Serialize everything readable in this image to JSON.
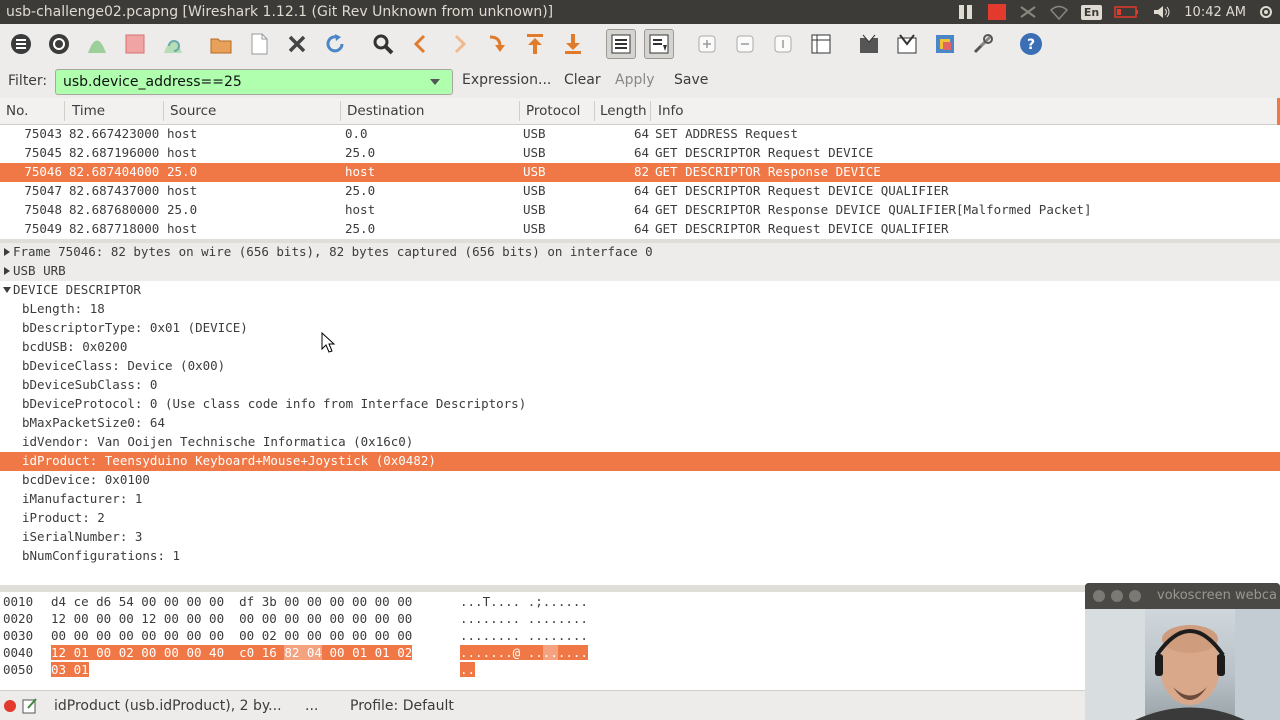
{
  "window": {
    "title": "usb-challenge02.pcapng   [Wireshark 1.12.1  (Git Rev Unknown from unknown)]",
    "tray": {
      "lang": "En",
      "time": "10:42 AM"
    }
  },
  "toolbar": {
    "icons": [
      "interfaces-icon",
      "options-icon",
      "start-capture-icon",
      "stop-capture-icon",
      "restart-capture-icon",
      "open-file-icon",
      "save-file-icon",
      "close-file-icon",
      "reload-icon",
      "find-packet-icon",
      "go-back-icon",
      "go-forward-icon",
      "go-to-packet-icon",
      "go-first-icon",
      "go-last-icon",
      "colorize-icon",
      "autoscroll-icon",
      "zoom-in-icon",
      "zoom-out-icon",
      "normal-size-icon",
      "resize-columns-icon",
      "capture-filters-icon",
      "display-filters-icon",
      "coloring-rules-icon",
      "preferences-icon",
      "help-icon"
    ]
  },
  "filter": {
    "label": "Filter:",
    "value": "usb.device_address==25",
    "expression_label": "Expression...",
    "clear_label": "Clear",
    "apply_label": "Apply",
    "save_label": "Save"
  },
  "packet_list": {
    "columns": [
      "No.",
      "Time",
      "Source",
      "Destination",
      "Protocol",
      "Length",
      "Info"
    ],
    "rows": [
      {
        "no": "75043",
        "time": "82.667423000",
        "source": "host",
        "destination": "0.0",
        "protocol": "USB",
        "length": "64",
        "info": "SET ADDRESS Request"
      },
      {
        "no": "75045",
        "time": "82.687196000",
        "source": "host",
        "destination": "25.0",
        "protocol": "USB",
        "length": "64",
        "info": "GET DESCRIPTOR Request DEVICE"
      },
      {
        "no": "75046",
        "time": "82.687404000",
        "source": "25.0",
        "destination": "host",
        "protocol": "USB",
        "length": "82",
        "info": "GET DESCRIPTOR Response DEVICE"
      },
      {
        "no": "75047",
        "time": "82.687437000",
        "source": "host",
        "destination": "25.0",
        "protocol": "USB",
        "length": "64",
        "info": "GET DESCRIPTOR Request DEVICE QUALIFIER"
      },
      {
        "no": "75048",
        "time": "82.687680000",
        "source": "25.0",
        "destination": "host",
        "protocol": "USB",
        "length": "64",
        "info": "GET DESCRIPTOR Response DEVICE QUALIFIER[Malformed Packet]"
      },
      {
        "no": "75049",
        "time": "82.687718000",
        "source": "host",
        "destination": "25.0",
        "protocol": "USB",
        "length": "64",
        "info": "GET DESCRIPTOR Request DEVICE QUALIFIER"
      }
    ],
    "selected_index": 2
  },
  "details": {
    "frame": "Frame 75046: 82 bytes on wire (656 bits), 82 bytes captured (656 bits) on interface 0",
    "urb": "USB URB",
    "descriptor": "DEVICE DESCRIPTOR",
    "fields": [
      "bLength: 18",
      "bDescriptorType: 0x01 (DEVICE)",
      "bcdUSB: 0x0200",
      "bDeviceClass: Device (0x00)",
      "bDeviceSubClass: 0",
      "bDeviceProtocol: 0 (Use class code info from Interface Descriptors)",
      "bMaxPacketSize0: 64",
      "idVendor: Van Ooijen Technische Informatica (0x16c0)",
      "idProduct: Teensyduino Keyboard+Mouse+Joystick (0x0482)",
      "bcdDevice: 0x0100",
      "iManufacturer: 1",
      "iProduct: 2",
      "iSerialNumber: 3",
      "bNumConfigurations: 1"
    ],
    "selected_field_index": 8
  },
  "hex": {
    "rows": [
      {
        "offset": "0010",
        "b1": "d4 ce d6 54 00 00 00 00",
        "b2": "df 3b 00 00 00 00 00 00",
        "ascii": "...T.... .;......"
      },
      {
        "offset": "0020",
        "b1": "12 00 00 00 12 00 00 00",
        "b2": "00 00 00 00 00 00 00 00",
        "ascii": "........ ........"
      },
      {
        "offset": "0030",
        "b1": "00 00 00 00 00 00 00 00",
        "b2": "00 02 00 00 00 00 00 00",
        "ascii": "........ ........"
      },
      {
        "offset": "0040",
        "b1": "12 01 00 02 00 00 00 40",
        "b2a": "c0 16",
        "b2sel": "82 04",
        "b2b": "00 01 01 02",
        "ascii1": ".......@ ..",
        "ascii_sel": "..",
        "ascii2": "...."
      },
      {
        "offset": "0050",
        "b1": "03 01",
        "ascii": ".."
      }
    ]
  },
  "statusbar": {
    "field_info": "idProduct (usb.idProduct), 2 by...",
    "ellipsis": "...",
    "profile": "Profile: Default"
  },
  "webcam": {
    "title": "vokoscreen webcam"
  },
  "colors": {
    "selection": "#f07746",
    "filter_valid": "#afffaf",
    "titlebar": "#3c3b37"
  }
}
